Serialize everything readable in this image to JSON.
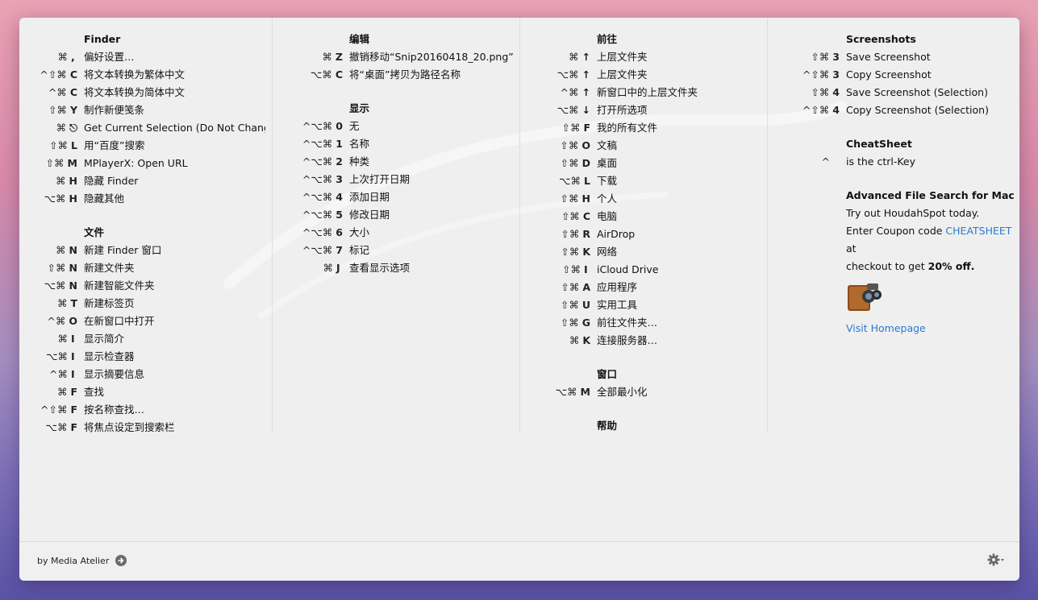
{
  "columns": [
    {
      "groups": [
        {
          "title": "Finder",
          "items": [
            {
              "keys": "⌘",
              "key": ",",
              "label": "偏好设置…"
            },
            {
              "keys": "^⇧⌘",
              "key": "C",
              "label": "将文本转换为繁体中文"
            },
            {
              "keys": "^⌘",
              "key": "C",
              "label": "将文本转换为简体中文"
            },
            {
              "keys": "⇧⌘",
              "key": "Y",
              "label": "制作新便笺条"
            },
            {
              "keys": "⌘",
              "key": "⎋",
              "label": "Get Current Selection (Do Not Change Sl"
            },
            {
              "keys": "⇧⌘",
              "key": "L",
              "label": "用“百度”搜索"
            },
            {
              "keys": "⇧⌘",
              "key": "M",
              "label": "MPlayerX: Open URL"
            },
            {
              "keys": "⌘",
              "key": "H",
              "label": "隐藏 Finder"
            },
            {
              "keys": "⌥⌘",
              "key": "H",
              "label": "隐藏其他"
            }
          ]
        },
        {
          "title": "文件",
          "items": [
            {
              "keys": "⌘",
              "key": "N",
              "label": "新建 Finder 窗口"
            },
            {
              "keys": "⇧⌘",
              "key": "N",
              "label": "新建文件夹"
            },
            {
              "keys": "⌥⌘",
              "key": "N",
              "label": "新建智能文件夹"
            },
            {
              "keys": "⌘",
              "key": "T",
              "label": "新建标签页"
            },
            {
              "keys": "^⌘",
              "key": "O",
              "label": "在新窗口中打开"
            },
            {
              "keys": "⌘",
              "key": "I",
              "label": "显示简介"
            },
            {
              "keys": "⌥⌘",
              "key": "I",
              "label": "显示检查器"
            },
            {
              "keys": "^⌘",
              "key": "I",
              "label": "显示摘要信息"
            },
            {
              "keys": "⌘",
              "key": "F",
              "label": "查找"
            },
            {
              "keys": "^⇧⌘",
              "key": "F",
              "label": "按名称查找…"
            },
            {
              "keys": "⌥⌘",
              "key": "F",
              "label": "将焦点设定到搜索栏"
            }
          ]
        }
      ]
    },
    {
      "groups": [
        {
          "title": "编辑",
          "items": [
            {
              "keys": "⌘",
              "key": "Z",
              "label": "撤销移动“Snip20160418_20.png”"
            },
            {
              "keys": "⌥⌘",
              "key": "C",
              "label": "将“桌面”拷贝为路径名称"
            }
          ]
        },
        {
          "title": "显示",
          "items": [
            {
              "keys": "^⌥⌘",
              "key": "0",
              "label": "无"
            },
            {
              "keys": "^⌥⌘",
              "key": "1",
              "label": "名称"
            },
            {
              "keys": "^⌥⌘",
              "key": "2",
              "label": "种类"
            },
            {
              "keys": "^⌥⌘",
              "key": "3",
              "label": "上次打开日期"
            },
            {
              "keys": "^⌥⌘",
              "key": "4",
              "label": "添加日期"
            },
            {
              "keys": "^⌥⌘",
              "key": "5",
              "label": "修改日期"
            },
            {
              "keys": "^⌥⌘",
              "key": "6",
              "label": "大小"
            },
            {
              "keys": "^⌥⌘",
              "key": "7",
              "label": "标记"
            },
            {
              "keys": "⌘",
              "key": "J",
              "label": "查看显示选项"
            }
          ]
        }
      ]
    },
    {
      "groups": [
        {
          "title": "前往",
          "items": [
            {
              "keys": "⌘",
              "key": "↑",
              "label": "上层文件夹"
            },
            {
              "keys": "⌥⌘",
              "key": "↑",
              "label": "上层文件夹"
            },
            {
              "keys": "^⌘",
              "key": "↑",
              "label": "新窗口中的上层文件夹"
            },
            {
              "keys": "⌥⌘",
              "key": "↓",
              "label": "打开所选项"
            },
            {
              "keys": "⇧⌘",
              "key": "F",
              "label": "我的所有文件"
            },
            {
              "keys": "⇧⌘",
              "key": "O",
              "label": "文稿"
            },
            {
              "keys": "⇧⌘",
              "key": "D",
              "label": "桌面"
            },
            {
              "keys": "⌥⌘",
              "key": "L",
              "label": "下载"
            },
            {
              "keys": "⇧⌘",
              "key": "H",
              "label": "个人"
            },
            {
              "keys": "⇧⌘",
              "key": "C",
              "label": "电脑"
            },
            {
              "keys": "⇧⌘",
              "key": "R",
              "label": "AirDrop"
            },
            {
              "keys": "⇧⌘",
              "key": "K",
              "label": "网络"
            },
            {
              "keys": "⇧⌘",
              "key": "I",
              "label": "iCloud Drive"
            },
            {
              "keys": "⇧⌘",
              "key": "A",
              "label": "应用程序"
            },
            {
              "keys": "⇧⌘",
              "key": "U",
              "label": "实用工具"
            },
            {
              "keys": "⇧⌘",
              "key": "G",
              "label": "前往文件夹…"
            },
            {
              "keys": "⌘",
              "key": "K",
              "label": "连接服务器…"
            }
          ]
        },
        {
          "title": "窗口",
          "items": [
            {
              "keys": "⌥⌘",
              "key": "M",
              "label": "全部最小化"
            }
          ]
        },
        {
          "title": "帮助",
          "items": []
        }
      ]
    },
    {
      "groups": [
        {
          "title": "Screenshots",
          "items": [
            {
              "keys": "⇧⌘",
              "key": "3",
              "label": "Save Screenshot"
            },
            {
              "keys": "^⇧⌘",
              "key": "3",
              "label": "Copy Screenshot"
            },
            {
              "keys": "⇧⌘",
              "key": "4",
              "label": "Save Screenshot (Selection)"
            },
            {
              "keys": "^⇧⌘",
              "key": "4",
              "label": "Copy Screenshot (Selection)"
            }
          ]
        },
        {
          "title": "CheatSheet",
          "items": [
            {
              "keys": "^",
              "key": "",
              "label": "is the ctrl-Key"
            }
          ]
        }
      ]
    }
  ],
  "promo": {
    "title": "Advanced File Search for Mac",
    "line1": "Try out HoudahSpot today.",
    "line2_prefix": "Enter Coupon code ",
    "coupon": "CHEATSHEET",
    "line2_suffix": " at",
    "line3_prefix": "checkout to get ",
    "discount": "20% off",
    "line3_suffix": ".",
    "link": "Visit Homepage",
    "icon": "houdahspot-binoculars-icon"
  },
  "footer": {
    "by": "by Media Atelier",
    "arrow_icon": "arrow-right-circle-icon",
    "gear_icon": "gear-icon"
  }
}
